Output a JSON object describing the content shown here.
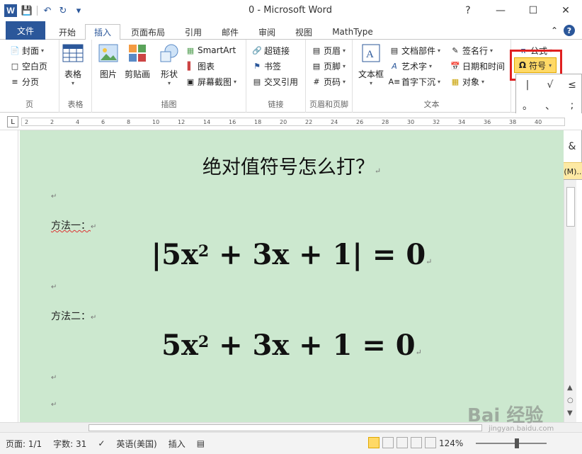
{
  "app": {
    "window_title": "0 - Microsoft Word",
    "logo": "W"
  },
  "quick_access": {
    "save_icon": "save-icon",
    "undo_icon": "undo-icon",
    "redo_icon": "redo-icon"
  },
  "tabs": [
    {
      "label": "文件"
    },
    {
      "label": "开始"
    },
    {
      "label": "插入"
    },
    {
      "label": "页面布局"
    },
    {
      "label": "引用"
    },
    {
      "label": "邮件"
    },
    {
      "label": "审阅"
    },
    {
      "label": "视图"
    },
    {
      "label": "MathType"
    }
  ],
  "ribbon": {
    "pages": {
      "cover": "封面",
      "blank": "空白页",
      "break": "分页",
      "label": "页"
    },
    "table": {
      "label_btn": "表格",
      "label": "表格"
    },
    "illustrations": {
      "picture": "图片",
      "clipart": "剪贴画",
      "shapes": "形状",
      "smartart": "SmartArt",
      "chart": "图表",
      "screenshot": "屏幕截图",
      "label": "插图"
    },
    "links": {
      "hyperlink": "超链接",
      "bookmark": "书签",
      "crossref": "交叉引用",
      "label": "链接"
    },
    "header_footer": {
      "header": "页眉",
      "footer": "页脚",
      "pagenum": "页码",
      "label": "页眉和页脚"
    },
    "text": {
      "textbox": "文本框",
      "quickparts": "文档部件",
      "wordart": "艺术字",
      "dropcap": "首字下沉",
      "signature": "签名行",
      "datetime": "日期和时间",
      "object": "对象",
      "label": "文本"
    },
    "symbols": {
      "equation": "公式",
      "symbol": "符号"
    }
  },
  "symbol_dropdown": {
    "symbols": [
      "|",
      "√",
      "≤",
      "。",
      "、",
      ";",
      "?",
      "“",
      "”",
      ")",
      "%",
      "&"
    ],
    "more": "其他符号(M)..."
  },
  "ruler_ticks": [
    "2",
    "2",
    "4",
    "6",
    "8",
    "10",
    "12",
    "14",
    "16",
    "18",
    "20",
    "22",
    "24",
    "26",
    "28",
    "30",
    "32",
    "34",
    "36",
    "38",
    "40"
  ],
  "document": {
    "title": "绝对值符号怎么打？",
    "method1": "方法一：",
    "method2": "方法二：",
    "formula1": {
      "base": "|5x",
      "exp": "2",
      "rest": " + 3x + 1| = 0"
    },
    "formula2": {
      "base": "5x",
      "exp": "2",
      "rest": " + 3x + 1 = 0"
    },
    "para_mark": "↵"
  },
  "status": {
    "page": "页面: 1/1",
    "words": "字数: 31",
    "language": "英语(美国)",
    "mode": "插入",
    "zoom": "124%"
  },
  "watermark": {
    "text": "Bai 经验",
    "url": "jingyan.baidu.com"
  },
  "colors": {
    "accent": "#2b579a",
    "page_bg": "#cce8cf",
    "highlight": "#e02020",
    "hover": "#ffd966"
  }
}
